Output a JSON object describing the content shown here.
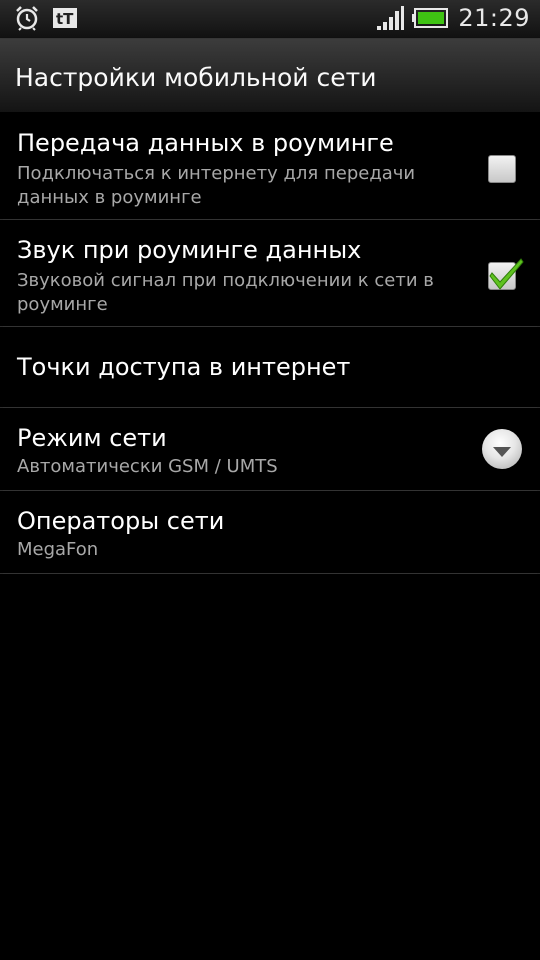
{
  "status_bar": {
    "time": "21:29",
    "icons": [
      "alarm-icon",
      "tt-notification-icon",
      "signal-strength-icon",
      "battery-icon"
    ],
    "battery_color": "#3fc313"
  },
  "title_bar": {
    "title": "Настройки мобильной сети"
  },
  "settings": [
    {
      "title": "Передача данных в роуминге",
      "summary": "Подключаться к интернету для передачи данных в роуминге",
      "control": "checkbox",
      "checked": false
    },
    {
      "title": "Звук при роуминге данных",
      "summary": "Звуковой сигнал при подключении к сети в роуминге",
      "control": "checkbox",
      "checked": true
    },
    {
      "title": "Точки доступа в интернет",
      "control": "none"
    },
    {
      "title": "Режим сети",
      "summary": "Автоматически GSM / UMTS",
      "control": "dropdown"
    },
    {
      "title": "Операторы сети",
      "summary": "MegaFon",
      "control": "none"
    }
  ],
  "colors": {
    "background": "#000000",
    "checkmark": "#5fc21f",
    "secondary_text": "#a8a8a8"
  }
}
